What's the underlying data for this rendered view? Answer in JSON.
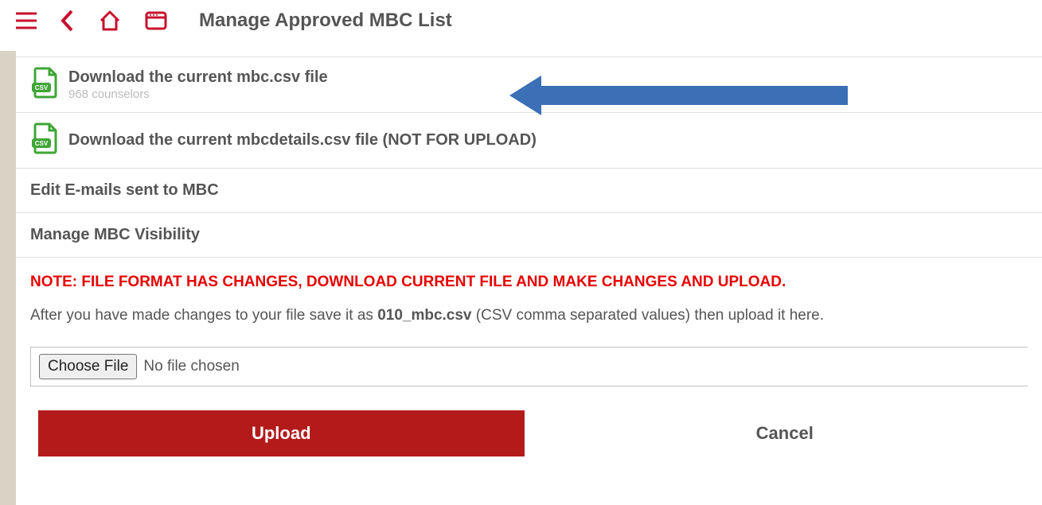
{
  "header": {
    "title": "Manage Approved MBC List"
  },
  "items": {
    "download_mbc": {
      "title": "Download the current mbc.csv file",
      "subtitle": "968 counselors"
    },
    "download_details": {
      "title": "Download the current mbcdetails.csv file (NOT FOR UPLOAD)"
    },
    "edit_emails": {
      "title": "Edit E-mails sent to MBC"
    },
    "manage_visibility": {
      "title": "Manage MBC Visibility"
    }
  },
  "note": {
    "warning": "NOTE: FILE FORMAT HAS CHANGES, DOWNLOAD CURRENT FILE AND MAKE CHANGES AND UPLOAD.",
    "instr_pre": "After you have made changes to your file save it as ",
    "instr_bold": "010_mbc.csv",
    "instr_post": " (CSV comma separated values) then upload it here."
  },
  "file": {
    "choose_label": "Choose File",
    "status": "No file chosen"
  },
  "buttons": {
    "upload": "Upload",
    "cancel": "Cancel"
  }
}
